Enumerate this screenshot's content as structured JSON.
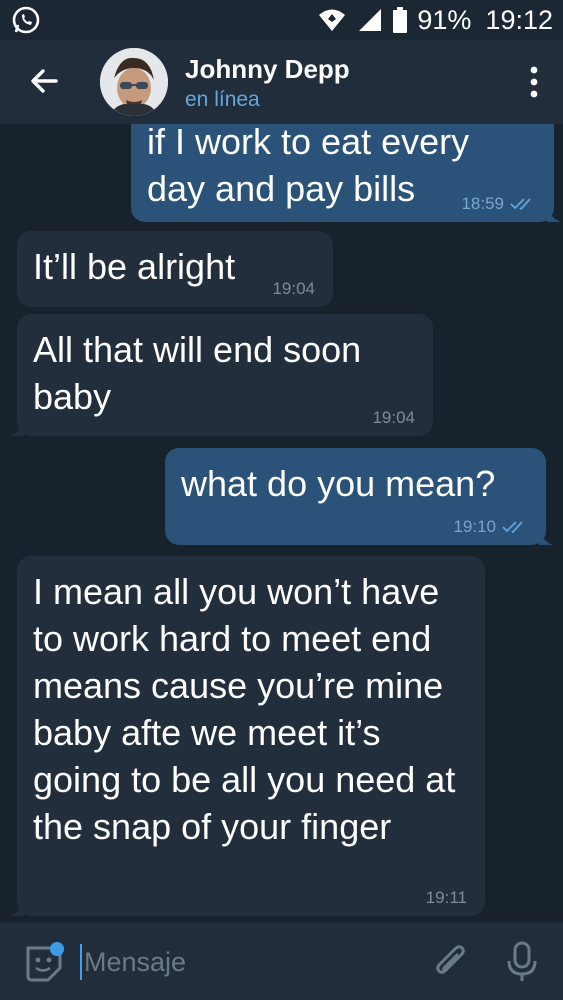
{
  "status_bar": {
    "battery_percent": "91%",
    "time": "19:12",
    "icons": [
      "whatsapp-icon",
      "wifi-icon",
      "signal-icon",
      "battery-icon"
    ]
  },
  "header": {
    "contact_name": "Johnny Depp",
    "contact_status": "en línea",
    "icons": [
      "back-arrow-icon",
      "more-vert-icon"
    ]
  },
  "messages": [
    {
      "direction": "out",
      "text": "if I work to eat every day and pay bills",
      "time": "18:59",
      "read": true
    },
    {
      "direction": "in",
      "text": "It’ll be alright",
      "time": "19:04"
    },
    {
      "direction": "in",
      "text": "All that will end soon baby",
      "time": "19:04"
    },
    {
      "direction": "out",
      "text": "what do you mean?",
      "time": "19:10",
      "read": true
    },
    {
      "direction": "in",
      "text": "I mean all you won’t have to work hard to meet end means cause you’re mine baby afte we meet it’s going to be all you need at the snap of your finger",
      "time": "19:11"
    }
  ],
  "input": {
    "placeholder": "Mensaje",
    "value": "",
    "icons": [
      "sticker-emoji-icon",
      "attach-paperclip-icon",
      "microphone-icon"
    ]
  },
  "colors": {
    "background": "#18222d",
    "header": "#212d3b",
    "incoming_bubble": "#222e3c",
    "outgoing_bubble": "#2b5278",
    "accent": "#62a6de",
    "read_check": "#62a6de"
  }
}
